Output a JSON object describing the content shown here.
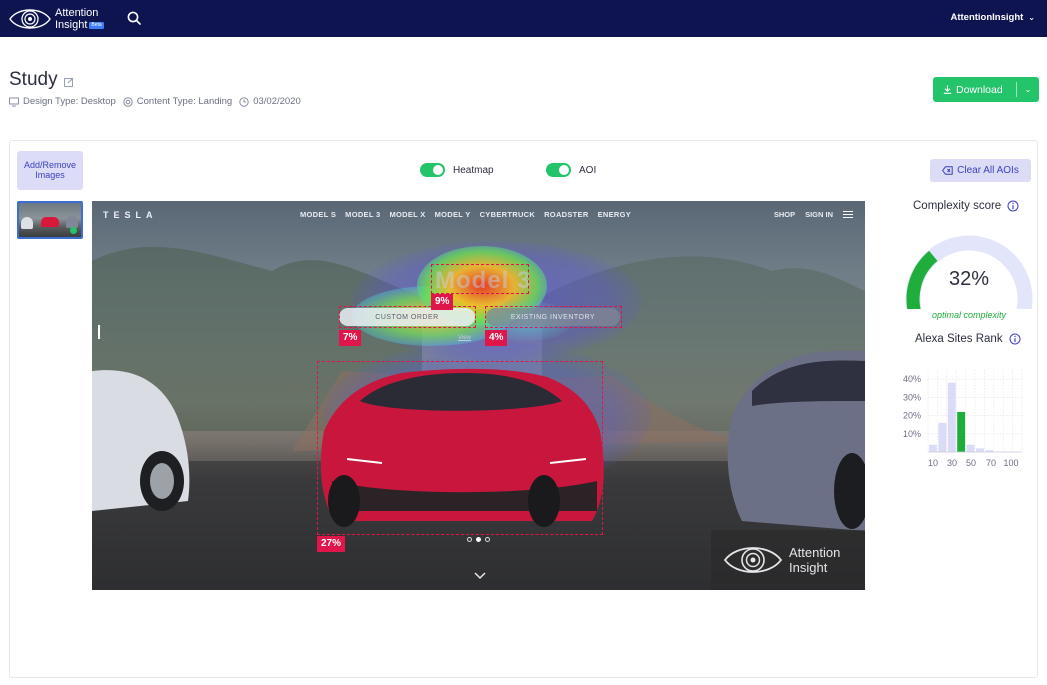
{
  "brand": {
    "line1": "Attention",
    "line2": "Insight",
    "badge": "Beta"
  },
  "account": {
    "name": "AttentionInsight"
  },
  "study": {
    "title": "Study",
    "design_type": "Design Type: Desktop",
    "content_type": "Content Type: Landing",
    "date": "03/02/2020"
  },
  "download": {
    "label": "Download"
  },
  "controls": {
    "add_remove": "Add/Remove Images",
    "heatmap_label": "Heatmap",
    "heatmap_on": true,
    "aoi_label": "AOI",
    "aoi_on": true,
    "clear_aois": "Clear All AOIs"
  },
  "site": {
    "logo": "TESLA",
    "nav": [
      "MODEL S",
      "MODEL 3",
      "MODEL X",
      "MODEL Y",
      "CYBERTRUCK",
      "ROADSTER",
      "ENERGY"
    ],
    "right": [
      "SHOP",
      "SIGN IN"
    ],
    "hero": "Model 3",
    "btn_custom": "CUSTOM ORDER",
    "btn_inventory": "EXISTING INVENTORY",
    "view_link": "View",
    "watermark_line1": "Attention",
    "watermark_line2": "Insight"
  },
  "aois": [
    {
      "label": "9%"
    },
    {
      "label": "7%"
    },
    {
      "label": "4%"
    },
    {
      "label": "27%"
    }
  ],
  "complexity": {
    "title": "Complexity score",
    "value": "32%",
    "fraction": 0.32,
    "caption": "optimal complexity",
    "accent": "#1fae3c",
    "track": "#e3e6fb"
  },
  "alexa": {
    "title": "Alexa Sites Rank"
  },
  "chart_data": {
    "type": "bar",
    "title": "Alexa Sites Rank",
    "x": [
      10,
      20,
      30,
      40,
      50,
      60,
      70,
      80,
      90,
      100
    ],
    "x_tick_labels": [
      "10",
      "30",
      "50",
      "70",
      "100"
    ],
    "y_tick_labels": [
      "10%",
      "20%",
      "30%",
      "40%"
    ],
    "values": [
      4,
      16,
      38,
      22,
      4,
      2,
      1,
      0,
      0,
      0
    ],
    "highlight_index": 3,
    "ylim": [
      0,
      45
    ],
    "colors": {
      "bar": "#dadcf7",
      "highlight": "#1fae3c"
    },
    "grid": true
  }
}
